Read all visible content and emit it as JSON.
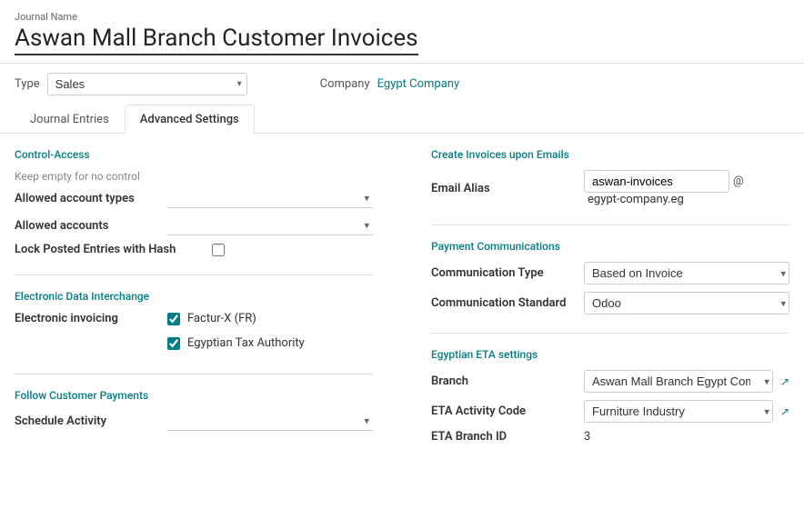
{
  "header": {
    "journal_name_label": "Journal Name",
    "title": "Aswan Mall Branch Customer Invoices"
  },
  "type_row": {
    "type_label": "Type",
    "type_value": "Sales",
    "company_label": "Company",
    "company_link": "Egypt Company"
  },
  "tabs": [
    {
      "id": "journal-entries",
      "label": "Journal Entries",
      "active": false
    },
    {
      "id": "advanced-settings",
      "label": "Advanced Settings",
      "active": true
    }
  ],
  "left_panel": {
    "control_access": {
      "section_title": "Control-Access",
      "hint": "Keep empty for no control",
      "allowed_types_label": "Allowed account types",
      "allowed_accounts_label": "Allowed accounts",
      "lock_label": "Lock Posted Entries with Hash"
    },
    "edi": {
      "section_title": "Electronic Data Interchange",
      "electronic_invoicing_label": "Electronic invoicing",
      "options": [
        {
          "label": "Factur-X (FR)",
          "checked": true
        },
        {
          "label": "Egyptian Tax Authority",
          "checked": true
        }
      ]
    },
    "follow_payments": {
      "section_title": "Follow Customer Payments",
      "schedule_label": "Schedule Activity"
    }
  },
  "right_panel": {
    "create_invoices": {
      "section_title": "Create Invoices upon Emails",
      "email_alias_label": "Email Alias",
      "email_alias_value": "aswan-invoices",
      "at_symbol": "@",
      "email_domain": "egypt-company.eg"
    },
    "payment_communications": {
      "section_title": "Payment Communications",
      "communication_type_label": "Communication Type",
      "communication_type_value": "Based on Invoice",
      "communication_standard_label": "Communication Standard",
      "communication_standard_value": "Odoo"
    },
    "eta_settings": {
      "section_title": "Egyptian ETA settings",
      "branch_label": "Branch",
      "branch_value": "Aswan Mall Branch Egypt Company",
      "eta_activity_code_label": "ETA Activity Code",
      "eta_activity_code_value": "Furniture Industry",
      "eta_branch_id_label": "ETA Branch ID",
      "eta_branch_id_value": "3"
    }
  }
}
